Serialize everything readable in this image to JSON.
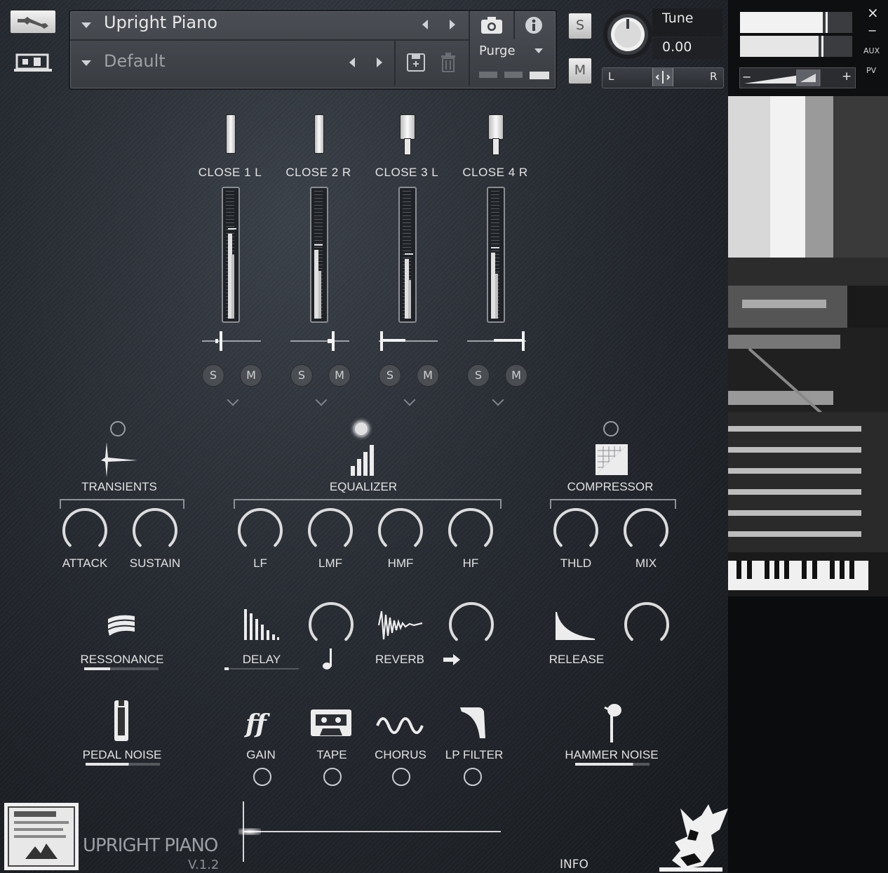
{
  "header": {
    "instrument_name": "Upright Piano",
    "preset_name": "Default",
    "purge_label": "Purge",
    "tune_label": "Tune",
    "tune_value": "0.00",
    "solo_label": "S",
    "mute_label": "M",
    "pan_left": "L",
    "pan_right": "R",
    "volume_minus": "−",
    "volume_plus": "+",
    "close_glyph": "×",
    "minimize_glyph": "−",
    "aux_label": "AUX",
    "pv_label": "PV"
  },
  "channels": [
    {
      "label": "CLOSE 1 L",
      "solo": "S",
      "mute": "M",
      "pan": 0.3,
      "level": 0.74
    },
    {
      "label": "CLOSE 2 R",
      "solo": "S",
      "mute": "M",
      "pan": 0.75,
      "level": 0.62
    },
    {
      "label": "CLOSE 3 L",
      "solo": "S",
      "mute": "M",
      "pan": 0.0,
      "level": 0.55
    },
    {
      "label": "CLOSE 4 R",
      "solo": "S",
      "mute": "M",
      "pan": 1.0,
      "level": 0.6
    }
  ],
  "modules": {
    "transients": {
      "label": "TRANSIENTS",
      "knobs": [
        "ATTACK",
        "SUSTAIN"
      ],
      "active": false
    },
    "equalizer": {
      "label": "EQUALIZER",
      "knobs": [
        "LF",
        "LMF",
        "HMF",
        "HF"
      ],
      "active": true
    },
    "compressor": {
      "label": "COMPRESSOR",
      "knobs": [
        "THLD",
        "MIX"
      ],
      "active": false
    }
  },
  "effects_row": {
    "ressonance": "RESSONANCE",
    "delay": "DELAY",
    "reverb": "REVERB",
    "release": "RELEASE"
  },
  "bottom_row": {
    "pedal_noise": "PEDAL NOISE",
    "gain": "GAIN",
    "tape": "TAPE",
    "chorus": "CHORUS",
    "lp_filter": "LP FILTER",
    "hammer_noise": "HAMMER NOISE"
  },
  "footer": {
    "product_name": "UPRIGHT PIANO",
    "version": "V.1.2",
    "info_label": "INFO"
  },
  "icons": {
    "wrench": "wrench-icon",
    "camera": "camera-icon",
    "info": "info-icon",
    "save": "save-icon",
    "delete": "trash-icon"
  }
}
